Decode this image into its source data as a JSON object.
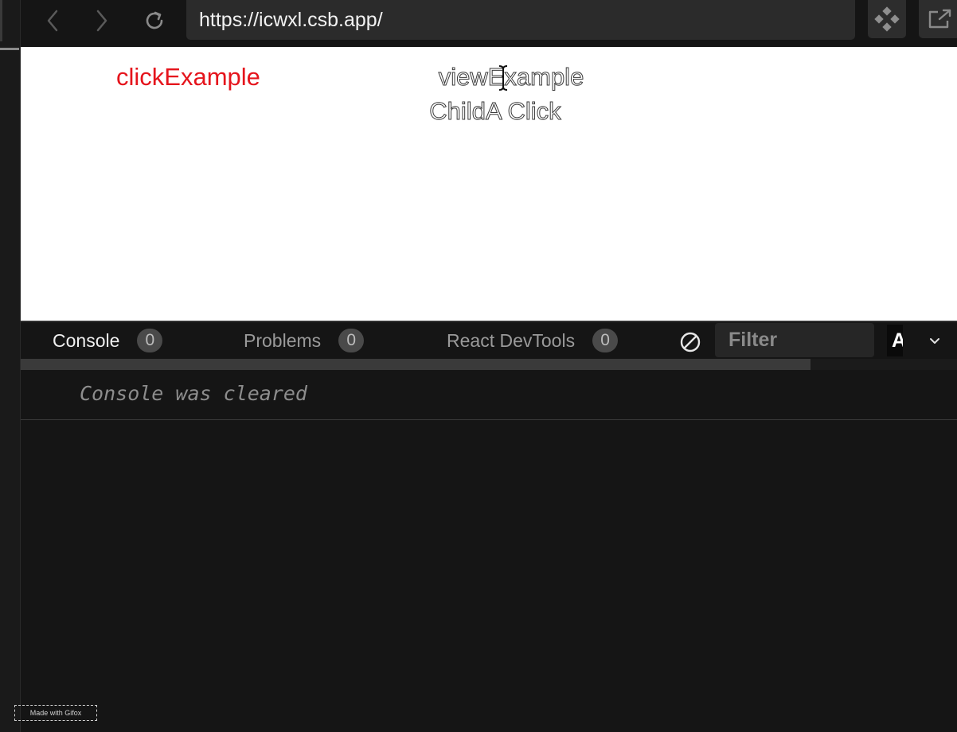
{
  "toolbar": {
    "back_icon": "chevron-left-icon",
    "forward_icon": "chevron-right-icon",
    "refresh_icon": "refresh-icon",
    "url": "https://icwxl.csb.app/",
    "codesandbox_icon": "codesandbox-icon",
    "open_new_window_icon": "open-external-icon"
  },
  "preview": {
    "click_example": "clickExample",
    "view_example": "viewExample",
    "child_click": "ChildA Click",
    "click_example_color": "#e5141c"
  },
  "devtools": {
    "tabs": [
      {
        "label": "Console",
        "count": "0",
        "active": true
      },
      {
        "label": "Problems",
        "count": "0",
        "active": false
      },
      {
        "label": "React DevTools",
        "count": "0",
        "active": false
      }
    ],
    "clear_icon": "clear-console-icon",
    "filter_placeholder": "Filter",
    "level_label": "A",
    "chevron_icon": "chevron-down-icon"
  },
  "console": {
    "message": "Console was cleared"
  },
  "watermark": {
    "text": "Made with Gifox"
  }
}
